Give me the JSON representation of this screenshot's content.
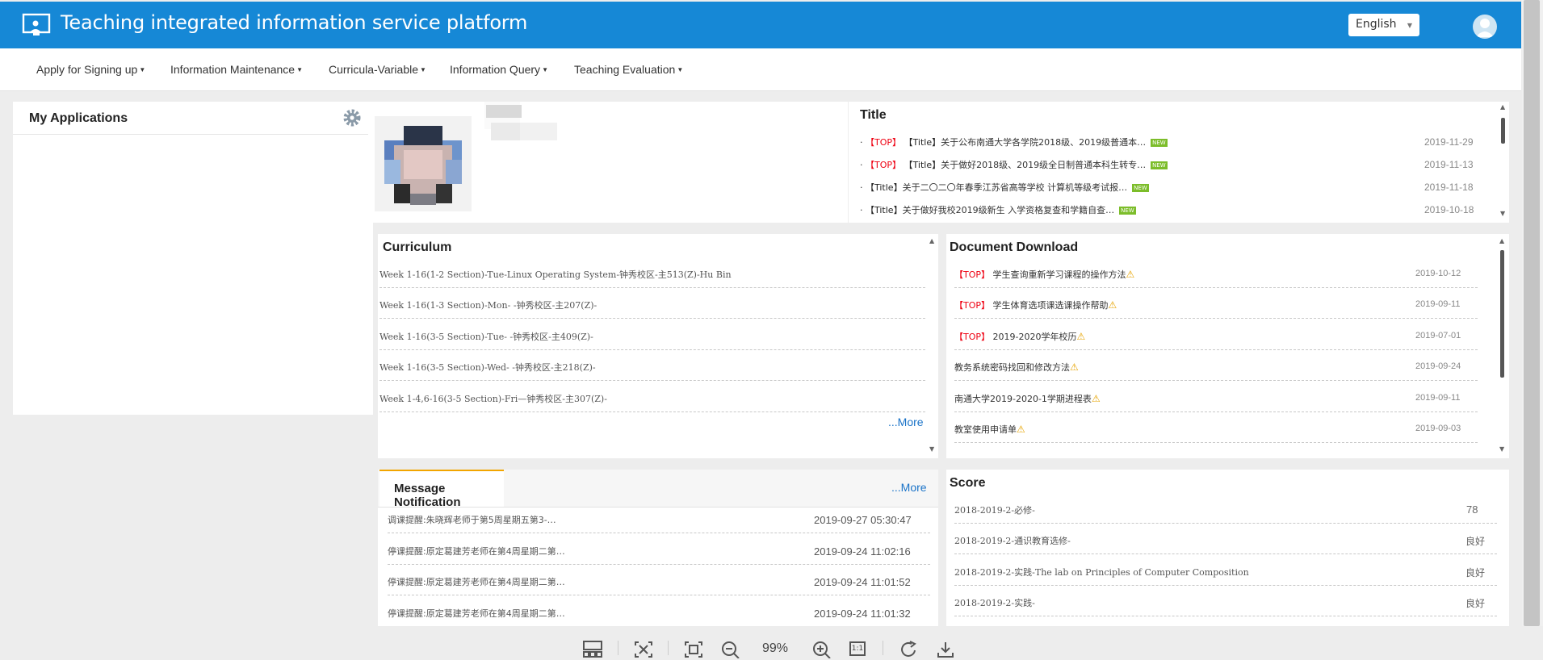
{
  "header": {
    "title": "Teaching integrated information service platform",
    "language": "English"
  },
  "nav": [
    {
      "label": "Apply for Signing up"
    },
    {
      "label": "Information Maintenance"
    },
    {
      "label": "Curricula-Variable"
    },
    {
      "label": "Information Query"
    },
    {
      "label": "Teaching Evaluation"
    }
  ],
  "my_applications": {
    "title": "My Applications"
  },
  "notices": {
    "title": "Title",
    "items": [
      {
        "top": "【TOP】",
        "tag": "【Title】",
        "text": "关于公布南通大学各学院2018级、2019级普通本…",
        "new": "NEW",
        "date": "2019-11-29"
      },
      {
        "top": "【TOP】",
        "tag": "【Title】",
        "text": "关于做好2018级、2019级全日制普通本科生转专…",
        "new": "NEW",
        "date": "2019-11-13"
      },
      {
        "top": "",
        "tag": "【Title】",
        "text": "关于二〇二〇年春季江苏省高等学校 计算机等级考试报…",
        "new": "NEW",
        "date": "2019-11-18"
      },
      {
        "top": "",
        "tag": "【Title】",
        "text": "关于做好我校2019级新生 入学资格复查和学籍自查…",
        "new": "NEW",
        "date": "2019-10-18"
      }
    ]
  },
  "curriculum": {
    "title": "Curriculum",
    "items": [
      "Week 1-16(1-2 Section)-Tue-Linux Operating System-钟秀校区-主513(Z)-Hu Bin",
      "Week 1-16(1-3 Section)-Mon- -钟秀校区-主207(Z)-",
      "Week 1-16(3-5 Section)-Tue- -钟秀校区-主409(Z)-",
      "Week 1-16(3-5 Section)-Wed- -钟秀校区-主218(Z)-",
      "Week 1-4,6-16(3-5 Section)-Fri—钟秀校区-主307(Z)-"
    ],
    "more": "...More"
  },
  "documents": {
    "title": "Document Download",
    "items": [
      {
        "top": "【TOP】",
        "text": "学生查询重新学习课程的操作方法",
        "date": "2019-10-12"
      },
      {
        "top": "【TOP】",
        "text": "学生体育选项课选课操作帮助",
        "date": "2019-09-11"
      },
      {
        "top": "【TOP】",
        "text": "2019-2020学年校历",
        "date": "2019-07-01"
      },
      {
        "top": "",
        "text": "教务系统密码找回和修改方法",
        "date": "2019-09-24"
      },
      {
        "top": "",
        "text": "南通大学2019-2020-1学期进程表",
        "date": "2019-09-11"
      },
      {
        "top": "",
        "text": "教室使用申请单",
        "date": "2019-09-03"
      }
    ]
  },
  "messages": {
    "tab_label": "Message Notification",
    "more": "...More",
    "items": [
      {
        "text": "调课提醒:朱晓辉老师于第5周星期五第3-…",
        "time": "2019-09-27 05:30:47"
      },
      {
        "text": "停课提醒:原定葛建芳老师在第4周星期二第…",
        "time": "2019-09-24 11:02:16"
      },
      {
        "text": "停课提醒:原定葛建芳老师在第4周星期二第…",
        "time": "2019-09-24 11:01:52"
      },
      {
        "text": "停课提醒:原定葛建芳老师在第4周星期二第…",
        "time": "2019-09-24 11:01:32"
      }
    ]
  },
  "score": {
    "title": "Score",
    "items": [
      {
        "course": "2018-2019-2-必修-",
        "value": "78"
      },
      {
        "course": "2018-2019-2-通识教育选修-",
        "value": "良好"
      },
      {
        "course": "2018-2019-2-实践-The lab on Principles of Computer Composition",
        "value": "良好"
      },
      {
        "course": "2018-2019-2-实践-",
        "value": "良好"
      }
    ]
  },
  "viewer": {
    "zoom": "99%",
    "actual_size": "1:1"
  },
  "colors": {
    "brand": "#1688d6",
    "link": "#1a73c8",
    "tab_accent": "#f2a500",
    "top_tag": "#e01111",
    "new_badge": "#7cbd2a"
  }
}
